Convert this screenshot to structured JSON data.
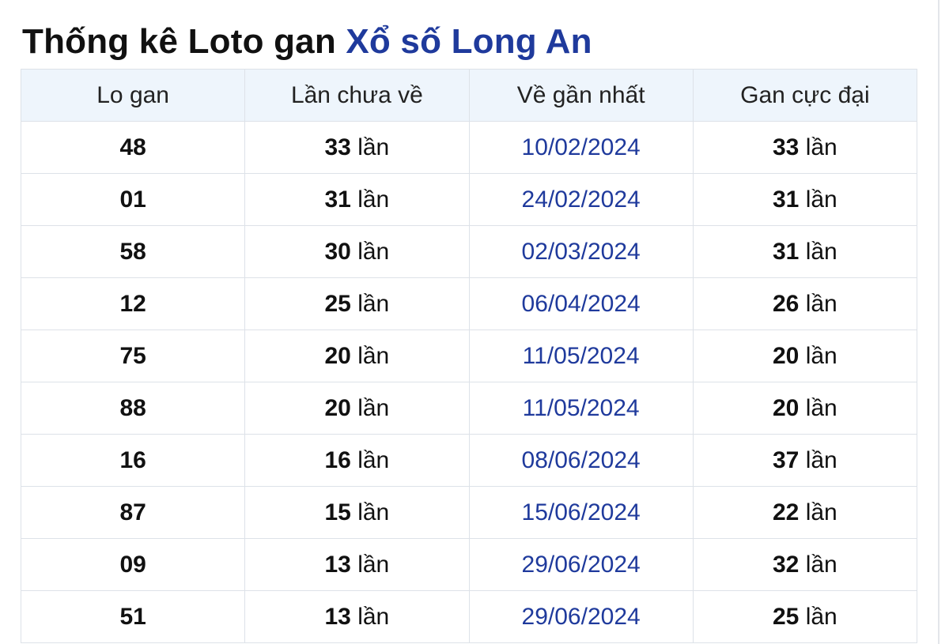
{
  "title": {
    "prefix": "Thống kê Loto gan ",
    "highlight": "Xổ số Long An"
  },
  "table": {
    "headers": [
      "Lo gan",
      "Lần chưa về",
      "Về gần nhất",
      "Gan cực đại"
    ],
    "unit": "lần",
    "rows": [
      {
        "lo": "48",
        "missed": "33",
        "last": "10/02/2024",
        "max": "33"
      },
      {
        "lo": "01",
        "missed": "31",
        "last": "24/02/2024",
        "max": "31"
      },
      {
        "lo": "58",
        "missed": "30",
        "last": "02/03/2024",
        "max": "31"
      },
      {
        "lo": "12",
        "missed": "25",
        "last": "06/04/2024",
        "max": "26"
      },
      {
        "lo": "75",
        "missed": "20",
        "last": "11/05/2024",
        "max": "20"
      },
      {
        "lo": "88",
        "missed": "20",
        "last": "11/05/2024",
        "max": "20"
      },
      {
        "lo": "16",
        "missed": "16",
        "last": "08/06/2024",
        "max": "37"
      },
      {
        "lo": "87",
        "missed": "15",
        "last": "15/06/2024",
        "max": "22"
      },
      {
        "lo": "09",
        "missed": "13",
        "last": "29/06/2024",
        "max": "32"
      },
      {
        "lo": "51",
        "missed": "13",
        "last": "29/06/2024",
        "max": "25"
      }
    ]
  }
}
